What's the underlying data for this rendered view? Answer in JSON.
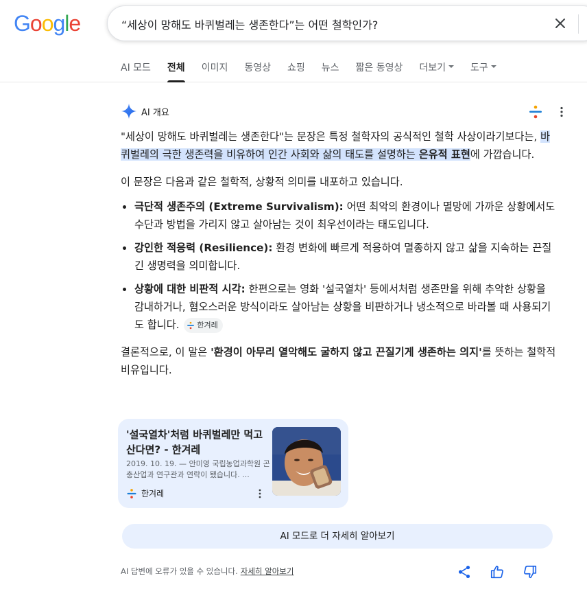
{
  "logo": {
    "letters": [
      "G",
      "o",
      "o",
      "g",
      "l",
      "e"
    ],
    "colors": [
      "#4285F4",
      "#EA4335",
      "#FBBC05",
      "#4285F4",
      "#34A853",
      "#EA4335"
    ]
  },
  "search": {
    "query": "“세상이 망해도 바퀴벌레는 생존한다”는 어떤 철학인가?"
  },
  "tabs": [
    {
      "label": "AI 모드",
      "active": false
    },
    {
      "label": "전체",
      "active": true
    },
    {
      "label": "이미지",
      "active": false
    },
    {
      "label": "동영상",
      "active": false
    },
    {
      "label": "쇼핑",
      "active": false
    },
    {
      "label": "뉴스",
      "active": false
    },
    {
      "label": "짧은 동영상",
      "active": false
    },
    {
      "label": "더보기",
      "active": false,
      "dropdown": true
    },
    {
      "label": "도구",
      "active": false,
      "dropdown": true
    }
  ],
  "ai_overview": {
    "title": "AI 개요",
    "p1_start": "\"세상이 망해도 바퀴벌레는 생존한다\"는 문장은 특정 철학자의 공식적인 철학 사상이라기보다는, ",
    "p1_highlight": "바퀴벌레의 극한 생존력을 비유하여 인간 사회와 삶의 태도를 설명하는 ",
    "p1_highlight_bold": "은유적 표현",
    "p1_end": "에 가깝습니다.",
    "p2": "이 문장은 다음과 같은 철학적, 상황적 의미를 내포하고 있습니다.",
    "bullets": [
      {
        "term": "극단적 생존주의 (Extreme Survivalism):",
        "text": " 어떤 최악의 환경이나 멸망에 가까운 상황에서도 수단과 방법을 가리지 않고 살아남는 것이 최우선이라는 태도입니다."
      },
      {
        "term": "강인한 적응력 (Resilience):",
        "text": " 환경 변화에 빠르게 적응하여 멸종하지 않고 삶을 지속하는 끈질긴 생명력을 의미합니다."
      },
      {
        "term": "상황에 대한 비판적 시각:",
        "text": " 한편으로는 영화 '설국열차' 등에서처럼 생존만을 위해 추악한 상황을 감내하거나, 혐오스러운 방식이라도 살아남는 상황을 비판하거나 냉소적으로 바라볼 때 사용되기도 합니다."
      }
    ],
    "citation": "한겨레",
    "conclusion_start": "결론적으로, 이 말은 ",
    "conclusion_bold": "'환경이 아무리 열악해도 굴하지 않고 끈질기게 생존하는 의지'",
    "conclusion_end": "를 뜻하는 철학적 비유입니다."
  },
  "card": {
    "title": "'설국열차'처럼 바퀴벌레만 먹고 산다면? - 한겨레",
    "snippet": "2019. 10. 19. — 안미영 국립농업과학원 곤충산업과 연구관과 연락이 됐습니다. ...",
    "source": "한겨레"
  },
  "ai_mode_button": "AI 모드로 더 자세히 알아보기",
  "footer": {
    "note": "AI 답변에 오류가 있을 수 있습니다.",
    "link": "자세히 알아보기"
  }
}
